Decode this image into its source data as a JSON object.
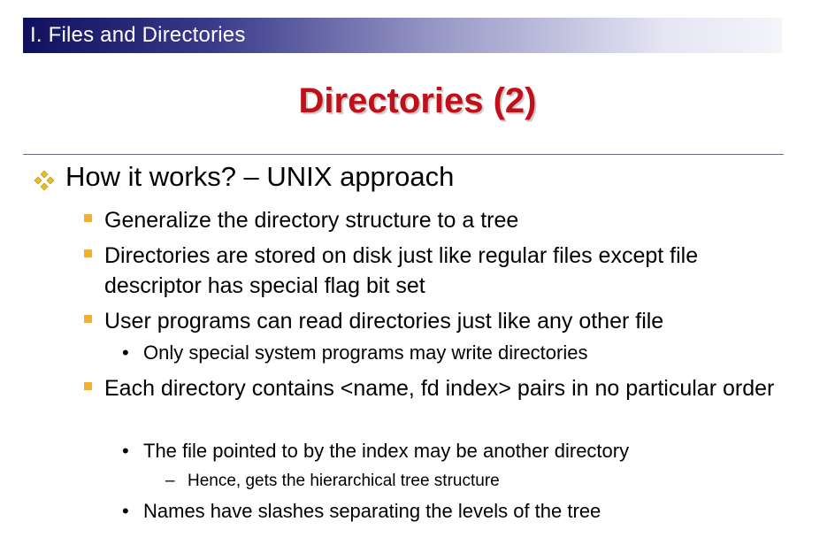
{
  "section": {
    "label": "I. Files and Directories"
  },
  "slide": {
    "title": "Directories (2)"
  },
  "colors": {
    "title": "#c0101a",
    "bullet_l2": "#f0b030",
    "bullet_l1": "#e8c020"
  },
  "content": {
    "heading": "How it works? – UNIX approach",
    "bullets": [
      {
        "text": "Generalize the directory structure to a tree"
      },
      {
        "text": "Directories are stored on disk just like regular files except file descriptor has special flag bit set"
      },
      {
        "text": "User programs can read directories just like any other file"
      },
      {
        "text": "Each directory contains <name, fd index> pairs in no particular order"
      }
    ],
    "sub": [
      {
        "text": "Only special system programs may write directories"
      },
      {
        "text": "The file pointed to by the index may be another directory"
      },
      {
        "text": "Names have slashes separating the levels of the tree"
      }
    ],
    "subsub": [
      {
        "text": "Hence, gets the hierarchical tree structure"
      }
    ],
    "bullet_marks": {
      "l3": "•",
      "l4": "–"
    }
  }
}
